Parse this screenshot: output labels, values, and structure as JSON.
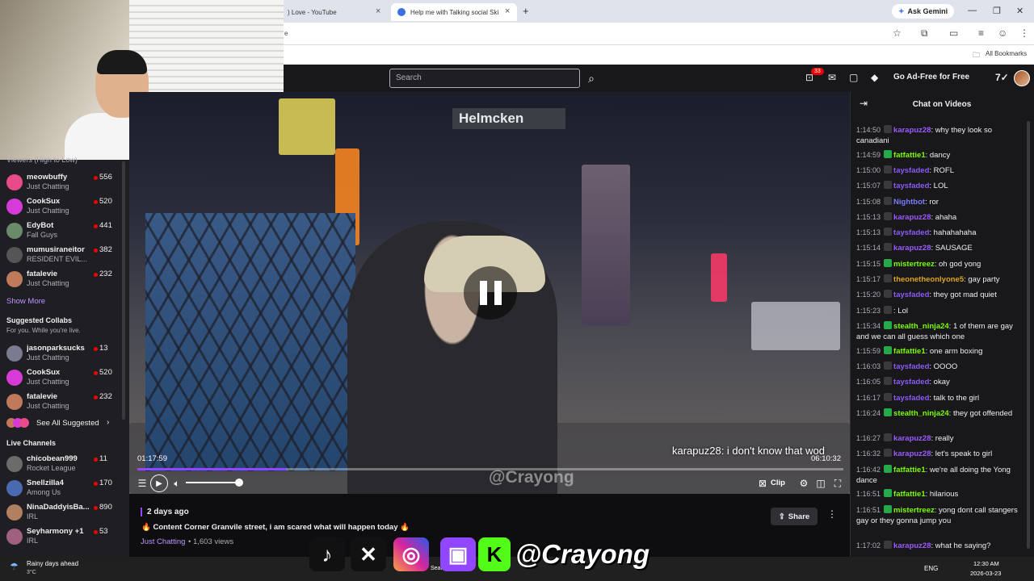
{
  "browser": {
    "tabs": [
      {
        "label": ") Love - YouTube",
        "close": "×"
      },
      {
        "label": "Help me with Talking social Ski",
        "close": "×"
      }
    ],
    "new_tab": "+",
    "gemini_label": "Ask Gemini",
    "address_partial": "e",
    "bookmarks_label": "All Bookmarks"
  },
  "topnav": {
    "search_placeholder": "Search",
    "notifications_count": "33",
    "ad_free_label": "Go Ad-Free for Free"
  },
  "sidebar": {
    "followed_heading": "Viewers (High to Low)",
    "followed": [
      {
        "name": "meowbuffy",
        "game": "Just Chatting",
        "viewers": "556",
        "color": "#e94b8a"
      },
      {
        "name": "CookSux",
        "game": "Just Chatting",
        "viewers": "520",
        "color": "#d63bd8"
      },
      {
        "name": "EdyBot",
        "game": "Fall Guys",
        "viewers": "441",
        "color": "#6a8a6a"
      },
      {
        "name": "mumusiraneitor",
        "game": "RESIDENT EVIL...",
        "viewers": "382",
        "color": "#555555"
      },
      {
        "name": "fatalevie",
        "game": "Just Chatting",
        "viewers": "232",
        "color": "#c07a5a"
      }
    ],
    "show_more": "Show More",
    "collabs_heading": "Suggested Collabs",
    "collabs_sub": "For you. While you're live.",
    "collabs": [
      {
        "name": "jasonparksucks",
        "game": "Just Chatting",
        "viewers": "13",
        "color": "#7a7a90"
      },
      {
        "name": "CookSux",
        "game": "Just Chatting",
        "viewers": "520",
        "color": "#d63bd8"
      },
      {
        "name": "fatalevie",
        "game": "Just Chatting",
        "viewers": "232",
        "color": "#c07a5a"
      }
    ],
    "see_all": "See All Suggested",
    "live_heading": "Live Channels",
    "live": [
      {
        "name": "chicobean999",
        "game": "Rocket League",
        "viewers": "11",
        "color": "#6b6b6b"
      },
      {
        "name": "Snellzilla4",
        "game": "Among Us",
        "viewers": "170",
        "color": "#4a6ab0"
      },
      {
        "name": "NinaDaddyisBa...",
        "game": "IRL",
        "viewers": "890",
        "color": "#b08060"
      },
      {
        "name": "Seyharmony +1",
        "game": "IRL",
        "viewers": "53",
        "color": "#a06080"
      }
    ]
  },
  "video": {
    "street_sign": "Helmcken",
    "overlay_chat": "karapuz28:  i don't know that wod",
    "overlay_handle": "@Crayong",
    "elapsed": "01:17:59",
    "duration": "06:10:32",
    "progress": 0.21,
    "clip_label": "Clip"
  },
  "info": {
    "posted": "2 days ago",
    "title": "🔥 Content Corner Granvile street, i am scared what will happen today 🔥",
    "category": "Just Chatting",
    "views": " • 1,603 views",
    "share_label": "Share"
  },
  "banner": {
    "handle": "@Crayong"
  },
  "chat": {
    "title": "Chat on Videos",
    "messages": [
      {
        "ts": "1:14:50",
        "user": "karapuz28",
        "color": "#9c5bff",
        "text": ": why they look so canadiani"
      },
      {
        "ts": "1:14:59",
        "user": "fatfattie1",
        "color": "#7cfc00",
        "text": ": dancy"
      },
      {
        "ts": "1:15:00",
        "user": "taysfaded",
        "color": "#8a5cf5",
        "text": ": ROFL"
      },
      {
        "ts": "1:15:07",
        "user": "taysfaded",
        "color": "#8a5cf5",
        "text": ": LOL"
      },
      {
        "ts": "1:15:08",
        "user": "Nightbot",
        "color": "#7b7bff",
        "text": ": ror"
      },
      {
        "ts": "1:15:13",
        "user": "karapuz28",
        "color": "#9c5bff",
        "text": ": ahaha"
      },
      {
        "ts": "1:15:13",
        "user": "taysfaded",
        "color": "#8a5cf5",
        "text": ": hahahahaha"
      },
      {
        "ts": "1:15:14",
        "user": "karapuz28",
        "color": "#9c5bff",
        "text": ": SAUSAGE"
      },
      {
        "ts": "1:15:15",
        "user": "mistertreez",
        "color": "#7cfc00",
        "text": ": oh god yong"
      },
      {
        "ts": "1:15:17",
        "user": "theonetheonlyone5",
        "color": "#daa520",
        "text": ": gay party"
      },
      {
        "ts": "1:15:20",
        "user": "taysfaded",
        "color": "#8a5cf5",
        "text": ": they got mad quiet"
      },
      {
        "ts": "1:15:23",
        "user": "",
        "color": "#3b5bdb",
        "text": ": Lol"
      },
      {
        "ts": "1:15:34",
        "user": "stealth_ninja24",
        "color": "#7cfc00",
        "text": ": 1 of them are gay and we can all guess which one"
      },
      {
        "ts": "1:15:59",
        "user": "fatfattie1",
        "color": "#7cfc00",
        "text": ": one arm boxing"
      },
      {
        "ts": "1:16:03",
        "user": "taysfaded",
        "color": "#8a5cf5",
        "text": ": OOOO"
      },
      {
        "ts": "1:16:05",
        "user": "taysfaded",
        "color": "#8a5cf5",
        "text": ": okay"
      },
      {
        "ts": "1:16:17",
        "user": "taysfaded",
        "color": "#8a5cf5",
        "text": ": talk to the girl"
      },
      {
        "ts": "1:16:24",
        "user": "stealth_ninja24",
        "color": "#7cfc00",
        "text": ": they got offended"
      },
      {
        "ts": "1:16:27",
        "user": "karapuz28",
        "color": "#9c5bff",
        "text": ": really"
      },
      {
        "ts": "1:16:32",
        "user": "karapuz28",
        "color": "#9c5bff",
        "text": ": let's speak to girl"
      },
      {
        "ts": "1:16:42",
        "user": "fatfattie1",
        "color": "#7cfc00",
        "text": ": we're all doing the Yong dance"
      },
      {
        "ts": "1:16:51",
        "user": "fatfattie1",
        "color": "#7cfc00",
        "text": ": hilarious"
      },
      {
        "ts": "1:16:51",
        "user": "mistertreez",
        "color": "#7cfc00",
        "text": ": yong dont call stangers gay or they gonna jump you"
      },
      {
        "ts": "1:17:02",
        "user": "karapuz28",
        "color": "#9c5bff",
        "text": ": what he saying?"
      }
    ]
  },
  "taskbar": {
    "weather_title": "Rainy days ahead",
    "weather_temp": "3°C",
    "search_label": "Search",
    "lang": "ENG",
    "time": "12:30 AM",
    "date": "2026-03-23"
  }
}
